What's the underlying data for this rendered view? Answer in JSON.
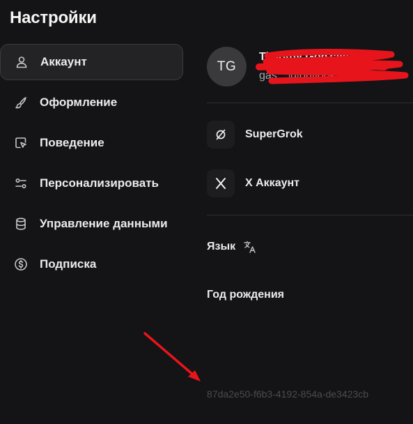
{
  "page": {
    "title": "Настройки"
  },
  "sidebar": {
    "items": [
      {
        "label": "Аккаунт",
        "icon": "user-icon",
        "active": true
      },
      {
        "label": "Оформление",
        "icon": "brush-icon"
      },
      {
        "label": "Поведение",
        "icon": "cursor-icon"
      },
      {
        "label": "Персонализировать",
        "icon": "sliders-icon"
      },
      {
        "label": "Управление данными",
        "icon": "database-icon"
      },
      {
        "label": "Подписка",
        "icon": "dollar-circle-icon"
      }
    ]
  },
  "account": {
    "avatar_initials": "TG",
    "name": "Timothy Gonzalez",
    "email": "gas…@outlook.com"
  },
  "links": [
    {
      "label": "SuperGrok",
      "icon": "supergrok-icon"
    },
    {
      "label": "X Аккаунт",
      "icon": "x-logo-icon"
    }
  ],
  "settings": {
    "language_label": "Язык",
    "language_icon": "translate-icon",
    "birth_year_label": "Год рождения"
  },
  "footer": {
    "uuid": "87da2e50-f6b3-4192-854a-de3423cb"
  },
  "colors": {
    "background": "#141416",
    "active_item": "#232326",
    "annotation_red": "#e8141c"
  }
}
